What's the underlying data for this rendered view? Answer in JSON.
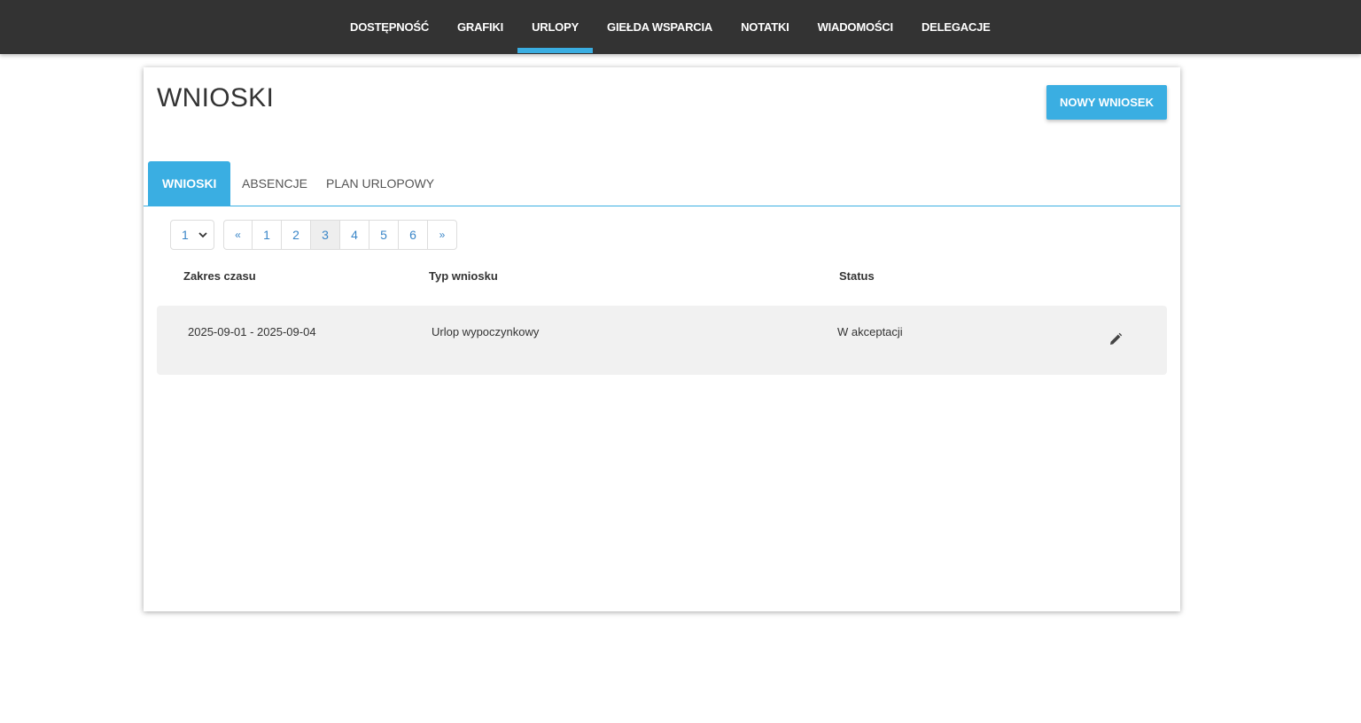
{
  "nav": {
    "items": [
      {
        "label": "DOSTĘPNOŚĆ"
      },
      {
        "label": "GRAFIKI"
      },
      {
        "label": "URLOPY",
        "active": true
      },
      {
        "label": "GIEŁDA WSPARCIA"
      },
      {
        "label": "NOTATKI"
      },
      {
        "label": "WIADOMOŚCI"
      },
      {
        "label": "DELEGACJE"
      }
    ]
  },
  "page": {
    "title": "WNIOSKI",
    "new_button_label": "NOWY WNIOSEK"
  },
  "tabs": [
    {
      "label": "WNIOSKI",
      "active": true
    },
    {
      "label": "ABSENCJE"
    },
    {
      "label": "PLAN URLOPOWY"
    }
  ],
  "pagination": {
    "select_value": "1",
    "prev": "«",
    "next": "»",
    "pages": [
      "1",
      "2",
      "3",
      "4",
      "5",
      "6"
    ],
    "active_page": "3"
  },
  "table": {
    "headers": [
      "Zakres czasu",
      "Typ wniosku",
      "Status"
    ],
    "rows": [
      {
        "range": "2025-09-01 - 2025-09-04",
        "type": "Urlop wypoczynkowy",
        "status": "W akceptacji",
        "action_icon": "pencil-icon"
      }
    ]
  },
  "colors": {
    "nav_bg": "#333333",
    "accent": "#3aaee2",
    "link": "#3a86c8",
    "row_bg": "#f1f1f1"
  }
}
